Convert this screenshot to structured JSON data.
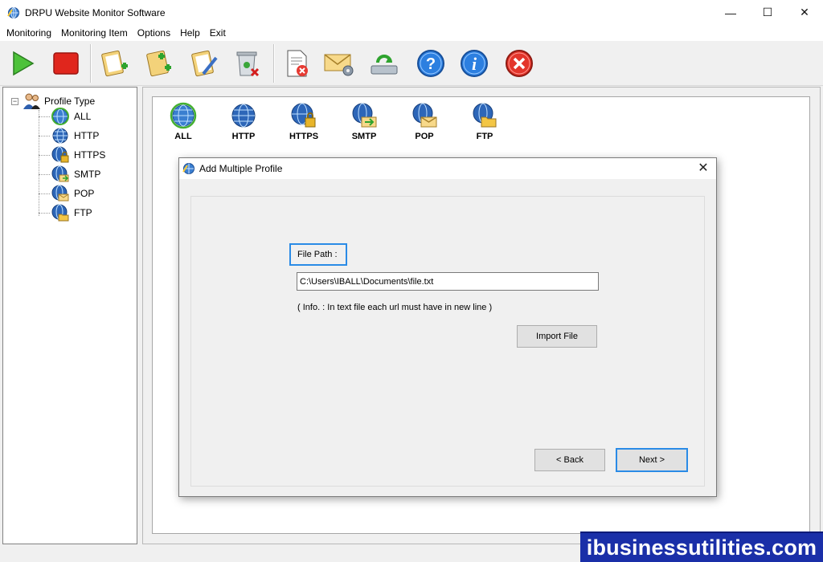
{
  "window": {
    "title": "DRPU Website Monitor Software",
    "controls": {
      "minimize": "—",
      "maximize": "☐",
      "close": "✕"
    }
  },
  "menu": [
    "Monitoring",
    "Monitoring Item",
    "Options",
    "Help",
    "Exit"
  ],
  "toolbar": {
    "buttons": [
      "start-icon",
      "stop-icon",
      "add-profile-icon",
      "add-multiple-profile-icon",
      "edit-profile-icon",
      "delete-profile-icon",
      "delete-report-icon",
      "email-settings-icon",
      "update-icon",
      "help-icon",
      "about-icon",
      "exit-icon"
    ]
  },
  "tree": {
    "root_label": "Profile Type",
    "expander": "−",
    "items": [
      "ALL",
      "HTTP",
      "HTTPS",
      "SMTP",
      "POP",
      "FTP"
    ]
  },
  "protocols": [
    "ALL",
    "HTTP",
    "HTTPS",
    "SMTP",
    "POP",
    "FTP"
  ],
  "dialog": {
    "title": "Add Multiple Profile",
    "close": "✕",
    "file_path_label": "File Path :",
    "file_path_value": "C:\\Users\\IBALL\\Documents\\file.txt",
    "info": "( Info. : In text file each url must have in new line )",
    "import_button": "Import File",
    "back_button": "< Back",
    "next_button": "Next >"
  },
  "watermark": "ibusinessutilities.com",
  "colors": {
    "focus": "#2a8be6",
    "banner": "#1a2fa8"
  }
}
